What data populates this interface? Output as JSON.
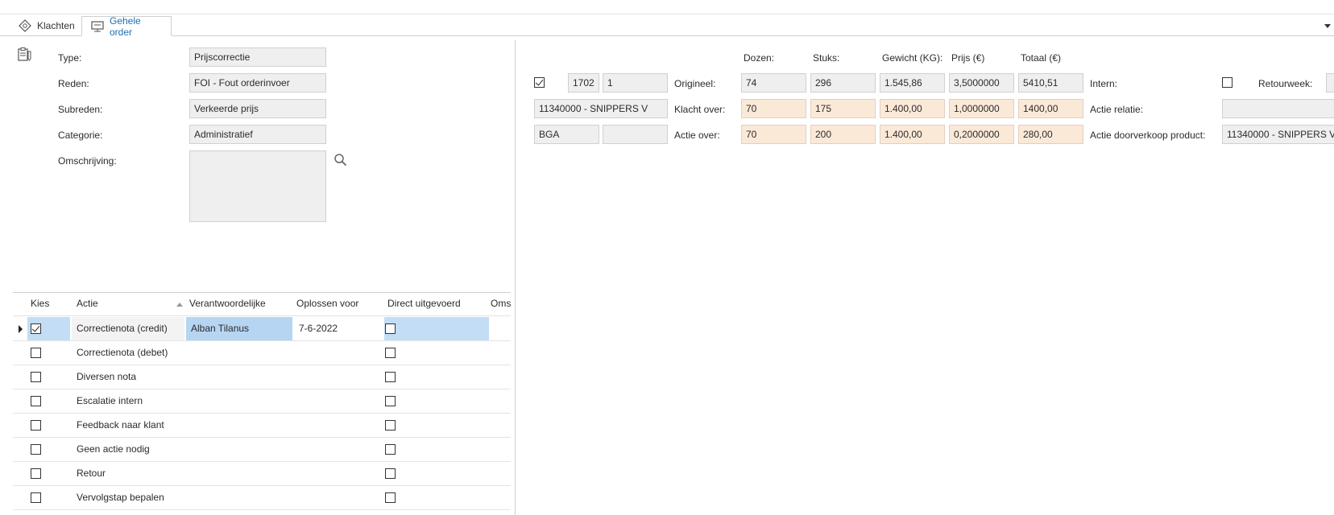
{
  "tabs": [
    {
      "label": "Klachten",
      "active": false
    },
    {
      "label": "Gehele order",
      "active": true
    }
  ],
  "form": {
    "type_label": "Type:",
    "type_value": "Prijscorrectie",
    "reden_label": "Reden:",
    "reden_value": "FOI - Fout orderinvoer",
    "subreden_label": "Subreden:",
    "subreden_value": "Verkeerde prijs",
    "categorie_label": "Categorie:",
    "categorie_value": "Administratief",
    "omschrijving_label": "Omschrijving:",
    "omschrijving_value": ""
  },
  "order": {
    "headers": {
      "dozen": "Dozen:",
      "stuks": "Stuks:",
      "gewicht": "Gewicht (KG):",
      "prijs": "Prijs (€)",
      "totaal": "Totaal (€)"
    },
    "selected": true,
    "order_nr": "1702",
    "line_nr": "1",
    "product": "11340000 - SNIPPERS V",
    "code": "BGA",
    "code2": "",
    "origineel": {
      "label": "Origineel:",
      "dozen": "74",
      "stuks": "296",
      "gewicht": "1.545,86",
      "prijs": "3,5000000",
      "totaal": "5410,51"
    },
    "klacht": {
      "label": "Klacht over:",
      "dozen": "70",
      "stuks": "175",
      "gewicht": "1.400,00",
      "prijs": "1,0000000",
      "totaal": "1400,00"
    },
    "actie": {
      "label": "Actie over:",
      "dozen": "70",
      "stuks": "200",
      "gewicht": "1.400,00",
      "prijs": "0,2000000",
      "totaal": "280,00"
    },
    "intern_label": "Intern:",
    "intern_checked": false,
    "retourweek_label": "Retourweek:",
    "retourweek_value": "",
    "actie_relatie_label": "Actie relatie:",
    "actie_relatie_value": "",
    "actie_doorverkoop_label": "Actie doorverkoop product:",
    "actie_doorverkoop_value": "11340000 - SNIPPERS V"
  },
  "grid": {
    "columns": [
      "Kies",
      "Actie",
      "Verantwoordelijke",
      "Oplossen voor",
      "Direct uitgevoerd",
      "Oms"
    ],
    "rows": [
      {
        "kies": true,
        "actie": "Correctienota (credit)",
        "verantwoordelijke": "Alban Tilanus",
        "oplossen_voor": "7-6-2022",
        "direct": false
      },
      {
        "kies": false,
        "actie": "Correctienota (debet)",
        "verantwoordelijke": "",
        "oplossen_voor": "",
        "direct": false
      },
      {
        "kies": false,
        "actie": "Diversen nota",
        "verantwoordelijke": "",
        "oplossen_voor": "",
        "direct": false
      },
      {
        "kies": false,
        "actie": "Escalatie intern",
        "verantwoordelijke": "",
        "oplossen_voor": "",
        "direct": false
      },
      {
        "kies": false,
        "actie": "Feedback naar klant",
        "verantwoordelijke": "",
        "oplossen_voor": "",
        "direct": false
      },
      {
        "kies": false,
        "actie": "Geen actie nodig",
        "verantwoordelijke": "",
        "oplossen_voor": "",
        "direct": false
      },
      {
        "kies": false,
        "actie": "Retour",
        "verantwoordelijke": "",
        "oplossen_voor": "",
        "direct": false
      },
      {
        "kies": false,
        "actie": "Vervolgstap bepalen",
        "verantwoordelijke": "",
        "oplossen_voor": "",
        "direct": false
      }
    ]
  },
  "icons": {
    "tab1": "complaint-diamond-icon",
    "tab2": "monitor-icon",
    "clipboard": "clipboard-icon",
    "search": "search-icon"
  }
}
